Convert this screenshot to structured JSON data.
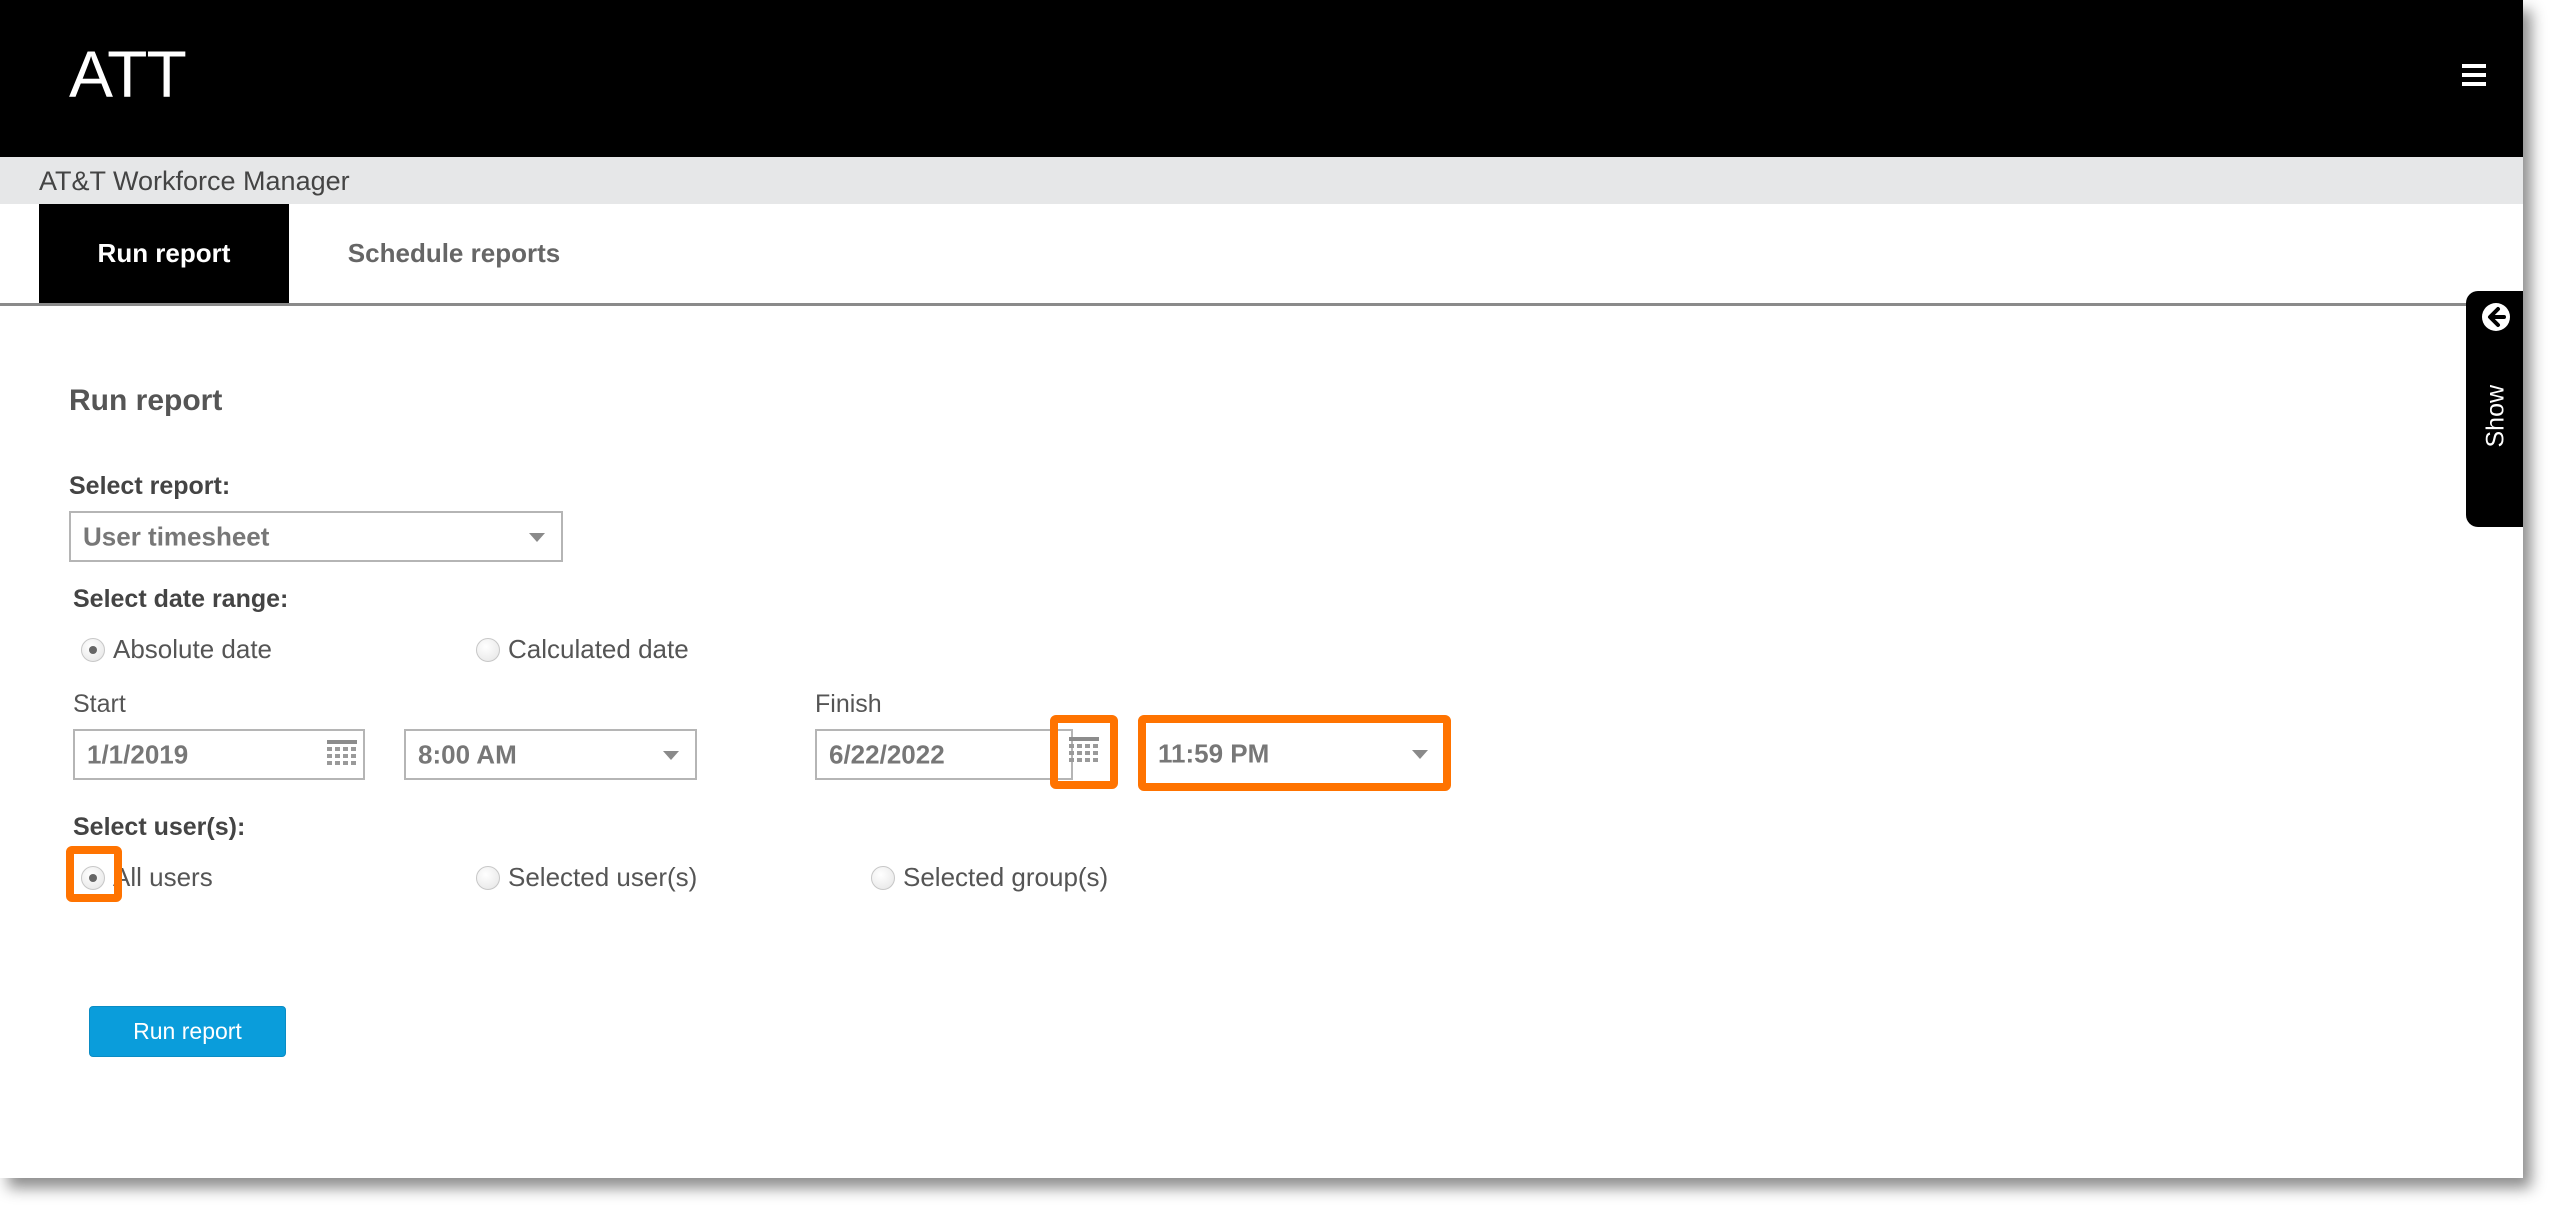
{
  "header": {
    "brand": "ATT",
    "menu_icon": "hamburger-menu-icon"
  },
  "subheader": {
    "title": "AT&T Workforce Manager"
  },
  "tabs": [
    {
      "label": "Run report",
      "active": true
    },
    {
      "label": "Schedule reports",
      "active": false
    }
  ],
  "form": {
    "title": "Run report",
    "select_report": {
      "label": "Select report:",
      "value": "User timesheet"
    },
    "date_range": {
      "label": "Select date range:",
      "options": [
        {
          "label": "Absolute date",
          "checked": true
        },
        {
          "label": "Calculated date",
          "checked": false
        }
      ]
    },
    "start": {
      "label": "Start",
      "date": "1/1/2019",
      "time": "8:00 AM"
    },
    "finish": {
      "label": "Finish",
      "date": "6/22/2022",
      "time": "11:59 PM"
    },
    "users": {
      "label": "Select user(s):",
      "options": [
        {
          "label": "All users",
          "checked": true
        },
        {
          "label": "Selected user(s)",
          "checked": false
        },
        {
          "label": "Selected group(s)",
          "checked": false
        }
      ]
    },
    "run_button": "Run report"
  },
  "side_panel": {
    "label": "Show",
    "icon": "arrow-left-circle-icon"
  },
  "highlight_color": "#ff7300",
  "accent_color": "#0a9ddb"
}
